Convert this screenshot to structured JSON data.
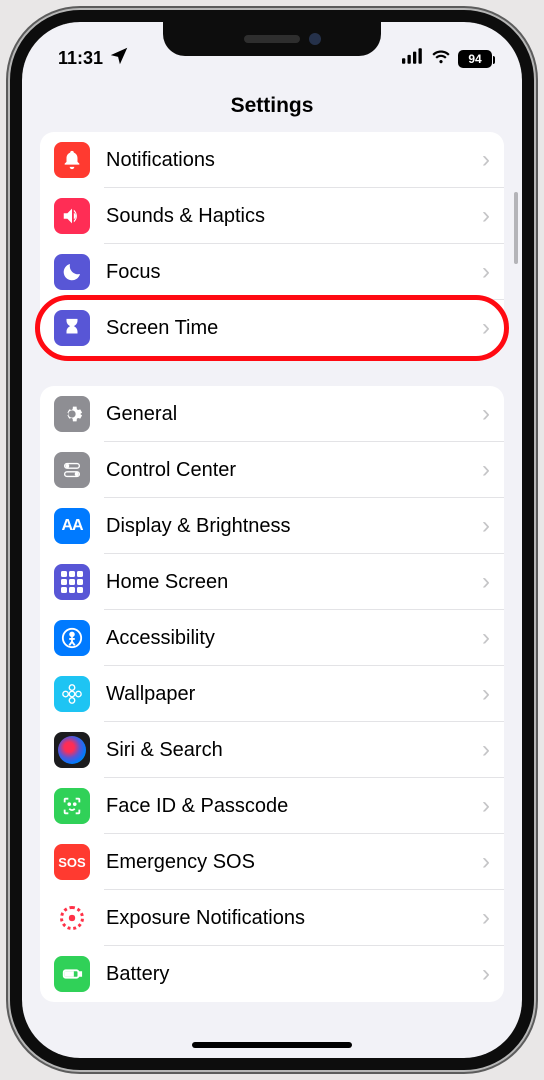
{
  "status": {
    "time": "11:31",
    "battery": "94"
  },
  "header": {
    "title": "Settings"
  },
  "groups": [
    {
      "rows": [
        {
          "id": "notifications",
          "label": "Notifications",
          "icon": "bell-icon",
          "bg": "bg-red",
          "highlighted": false
        },
        {
          "id": "sounds-haptics",
          "label": "Sounds & Haptics",
          "icon": "speaker-icon",
          "bg": "bg-pink",
          "highlighted": false
        },
        {
          "id": "focus",
          "label": "Focus",
          "icon": "moon-icon",
          "bg": "bg-indigo",
          "highlighted": false
        },
        {
          "id": "screen-time",
          "label": "Screen Time",
          "icon": "hourglass-icon",
          "bg": "bg-indigo",
          "highlighted": true
        }
      ]
    },
    {
      "rows": [
        {
          "id": "general",
          "label": "General",
          "icon": "gear-icon",
          "bg": "bg-gray",
          "highlighted": false
        },
        {
          "id": "control-center",
          "label": "Control Center",
          "icon": "switches-icon",
          "bg": "bg-gray",
          "highlighted": false
        },
        {
          "id": "display-brightness",
          "label": "Display & Brightness",
          "icon": "aa-icon",
          "bg": "bg-blue",
          "highlighted": false
        },
        {
          "id": "home-screen",
          "label": "Home Screen",
          "icon": "grid-icon",
          "bg": "bg-indigo",
          "highlighted": false
        },
        {
          "id": "accessibility",
          "label": "Accessibility",
          "icon": "person-icon",
          "bg": "bg-blue",
          "highlighted": false
        },
        {
          "id": "wallpaper",
          "label": "Wallpaper",
          "icon": "flower-icon",
          "bg": "bg-cyan",
          "highlighted": false
        },
        {
          "id": "siri-search",
          "label": "Siri & Search",
          "icon": "siri-icon",
          "bg": "bg-black",
          "highlighted": false
        },
        {
          "id": "face-id-passcode",
          "label": "Face ID & Passcode",
          "icon": "face-icon",
          "bg": "bg-green",
          "highlighted": false
        },
        {
          "id": "emergency-sos",
          "label": "Emergency SOS",
          "icon": "sos-icon",
          "bg": "bg-red",
          "highlighted": false
        },
        {
          "id": "exposure-notifications",
          "label": "Exposure Notifications",
          "icon": "exposure-icon",
          "bg": "bg-white-pink",
          "highlighted": false
        },
        {
          "id": "battery",
          "label": "Battery",
          "icon": "battery-icon",
          "bg": "bg-green",
          "highlighted": false
        }
      ]
    }
  ]
}
